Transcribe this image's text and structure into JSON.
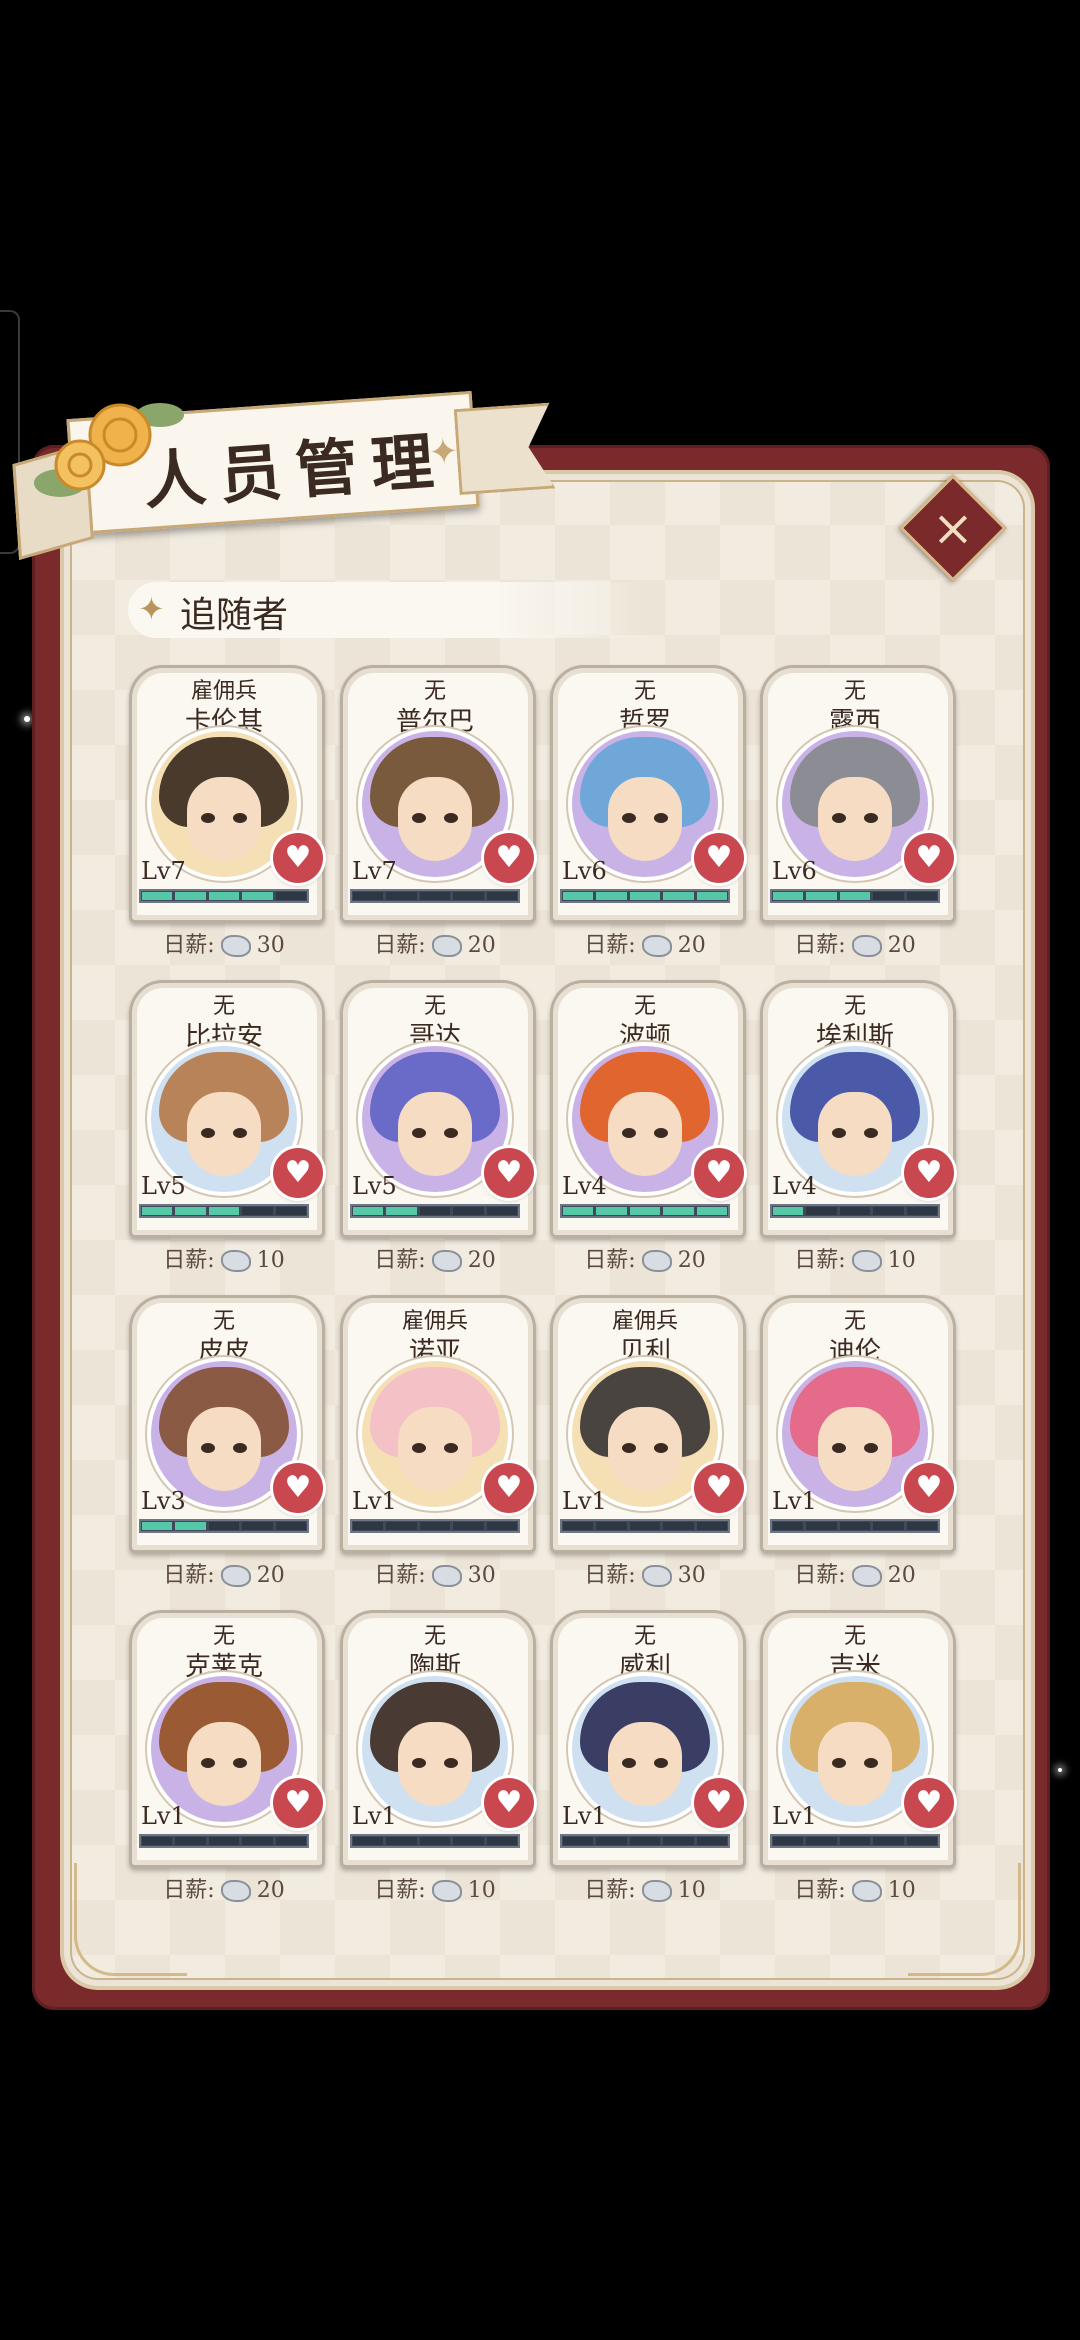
{
  "header": {
    "title": "人员管理",
    "section_label": "追随者",
    "close_label": "×"
  },
  "colors": {
    "panel_red": "#7a2a2b",
    "parchment": "#ece4d6",
    "bar_fill": "#56c7a7",
    "heart": "#c9474f"
  },
  "wage_label": "日薪:",
  "followers": [
    {
      "role": "雇佣兵",
      "name": "卡伦其",
      "level": "Lv7",
      "exp_segments": 4,
      "wage": "30",
      "frame": "gold",
      "hair": "#4a3a2c"
    },
    {
      "role": "无",
      "name": "普尔巴",
      "level": "Lv7",
      "exp_segments": 0,
      "wage": "20",
      "frame": "purple",
      "hair": "#7a5a3c"
    },
    {
      "role": "无",
      "name": "哲罗",
      "level": "Lv6",
      "exp_segments": 5,
      "wage": "20",
      "frame": "purple",
      "hair": "#6ea7d8"
    },
    {
      "role": "无",
      "name": "露西",
      "level": "Lv6",
      "exp_segments": 3,
      "wage": "20",
      "frame": "purple",
      "hair": "#8c8c94"
    },
    {
      "role": "无",
      "name": "比拉安",
      "level": "Lv5",
      "exp_segments": 3,
      "wage": "10",
      "frame": "blue",
      "hair": "#b9835a"
    },
    {
      "role": "无",
      "name": "哥达",
      "level": "Lv5",
      "exp_segments": 2,
      "wage": "20",
      "frame": "purple",
      "hair": "#6a6ac8"
    },
    {
      "role": "无",
      "name": "波顿",
      "level": "Lv4",
      "exp_segments": 5,
      "wage": "20",
      "frame": "purple",
      "hair": "#e0652e"
    },
    {
      "role": "无",
      "name": "埃利斯",
      "level": "Lv4",
      "exp_segments": 1,
      "wage": "10",
      "frame": "blue",
      "hair": "#4a5aa8"
    },
    {
      "role": "无",
      "name": "皮皮",
      "level": "Lv3",
      "exp_segments": 2,
      "wage": "20",
      "frame": "purple",
      "hair": "#8a5a44"
    },
    {
      "role": "雇佣兵",
      "name": "诺亚",
      "level": "Lv1",
      "exp_segments": 0,
      "wage": "30",
      "frame": "gold",
      "hair": "#f3c1c6"
    },
    {
      "role": "雇佣兵",
      "name": "贝利",
      "level": "Lv1",
      "exp_segments": 0,
      "wage": "30",
      "frame": "gold",
      "hair": "#4a4440"
    },
    {
      "role": "无",
      "name": "迪伦",
      "level": "Lv1",
      "exp_segments": 0,
      "wage": "20",
      "frame": "purple",
      "hair": "#e56b8a"
    },
    {
      "role": "无",
      "name": "克莱克",
      "level": "Lv1",
      "exp_segments": 0,
      "wage": "20",
      "frame": "purple",
      "hair": "#9a5a34"
    },
    {
      "role": "无",
      "name": "陶斯",
      "level": "Lv1",
      "exp_segments": 0,
      "wage": "10",
      "frame": "blue",
      "hair": "#4a3a34"
    },
    {
      "role": "无",
      "name": "威利",
      "level": "Lv1",
      "exp_segments": 0,
      "wage": "10",
      "frame": "blue",
      "hair": "#3a3e64"
    },
    {
      "role": "无",
      "name": "吉米",
      "level": "Lv1",
      "exp_segments": 0,
      "wage": "10",
      "frame": "blue",
      "hair": "#d8b06a"
    }
  ]
}
